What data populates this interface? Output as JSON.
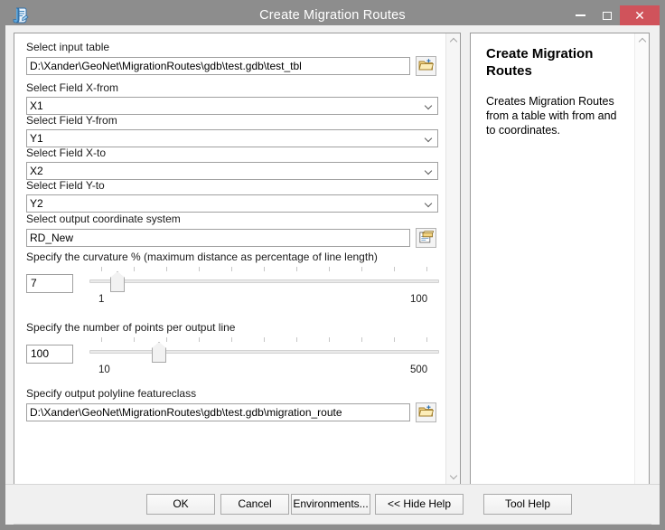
{
  "window": {
    "title": "Create Migration Routes",
    "icon": "script-tool-icon",
    "controls": {
      "minimize": "minimize-icon",
      "maximize": "maximize-icon",
      "close": "✕"
    },
    "colors": {
      "titlebar": "#8d8d8d",
      "close_button": "#d0535b",
      "dialog_background": "#f0f0f0",
      "panel_background": "#ffffff",
      "border": "#9a9a9a"
    }
  },
  "parameters": {
    "input_table": {
      "label": "Select input table",
      "value": "D:\\Xander\\GeoNet\\MigrationRoutes\\gdb\\test.gdb\\test_tbl",
      "browse_icon": "open-folder-icon"
    },
    "x_from": {
      "label": "Select Field X-from",
      "value": "X1"
    },
    "y_from": {
      "label": "Select Field Y-from",
      "value": "Y1"
    },
    "x_to": {
      "label": "Select Field X-to",
      "value": "X2"
    },
    "y_to": {
      "label": "Select Field Y-to",
      "value": "Y2"
    },
    "coordinate_system": {
      "label": "Select output coordinate system",
      "value": "RD_New",
      "browse_icon": "spatial-reference-properties-icon"
    },
    "curvature": {
      "label": "Specify the curvature % (maximum distance as percentage of line length)",
      "value": "7",
      "min_label": "1",
      "max_label": "100",
      "min": 1,
      "max": 100,
      "ticks": 11
    },
    "points_per_line": {
      "label": "Specify the number of points per output line",
      "value": "100",
      "min_label": "10",
      "max_label": "500",
      "min": 10,
      "max": 500,
      "ticks": 11
    },
    "output_featureclass": {
      "label": "Specify output polyline featureclass",
      "value": "D:\\Xander\\GeoNet\\MigrationRoutes\\gdb\\test.gdb\\migration_route",
      "browse_icon": "open-folder-icon"
    }
  },
  "help": {
    "title": "Create Migration Routes",
    "body": "Creates Migration Routes from a table with from and to coordinates."
  },
  "footer": {
    "ok": "OK",
    "cancel": "Cancel",
    "environments": "Environments...",
    "hide_help": "<< Hide Help",
    "tool_help": "Tool Help"
  }
}
